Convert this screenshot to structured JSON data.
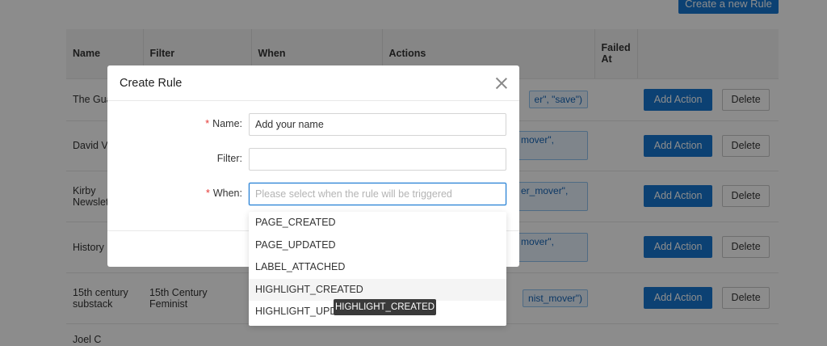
{
  "page": {
    "create_new_rule_label": "Create a new Rule"
  },
  "table": {
    "columns": [
      "Name",
      "Filter",
      "When",
      "Actions",
      "Failed At",
      ""
    ],
    "failed_at_line1": "Failed",
    "failed_at_line2": "At",
    "rows": [
      {
        "name": "The Gua",
        "filter": "",
        "action_tag": "er\", \"save\")"
      },
      {
        "name": "David Ve",
        "filter": "",
        "action_tag": "mover\","
      },
      {
        "name_line1": "Kirby",
        "name_line2": "Newslet",
        "filter": "",
        "action_tag": "er_mover\","
      },
      {
        "name": "History",
        "filter": "",
        "action_tag": "mover\","
      },
      {
        "name_line1": "15th century",
        "name_line2": "substack",
        "filter_line1": "15th Century",
        "filter_line2": "Feminist",
        "action_tag": "nist_mover\")"
      },
      {
        "name": "Joel C",
        "filter": "",
        "action_tag": ""
      }
    ],
    "add_action_label": "Add Action",
    "delete_label": "Delete"
  },
  "modal": {
    "title": "Create Rule",
    "fields": {
      "name": {
        "label": "Name",
        "value": "Add your name",
        "required": true
      },
      "filter": {
        "label": "Filter",
        "value": "",
        "required": false
      },
      "when": {
        "label": "When",
        "placeholder": "Please select when the rule will be triggered",
        "required": true
      }
    },
    "colon": ":",
    "required_mark": "*"
  },
  "dropdown": {
    "options": [
      "PAGE_CREATED",
      "PAGE_UPDATED",
      "LABEL_ATTACHED",
      "HIGHLIGHT_CREATED",
      "HIGHLIGHT_UPDATED"
    ],
    "hovered_index": 3
  },
  "tooltip": {
    "text": "HIGHLIGHT_CREATED"
  },
  "colors": {
    "primary": "#1677d2",
    "required": "#e53935"
  }
}
